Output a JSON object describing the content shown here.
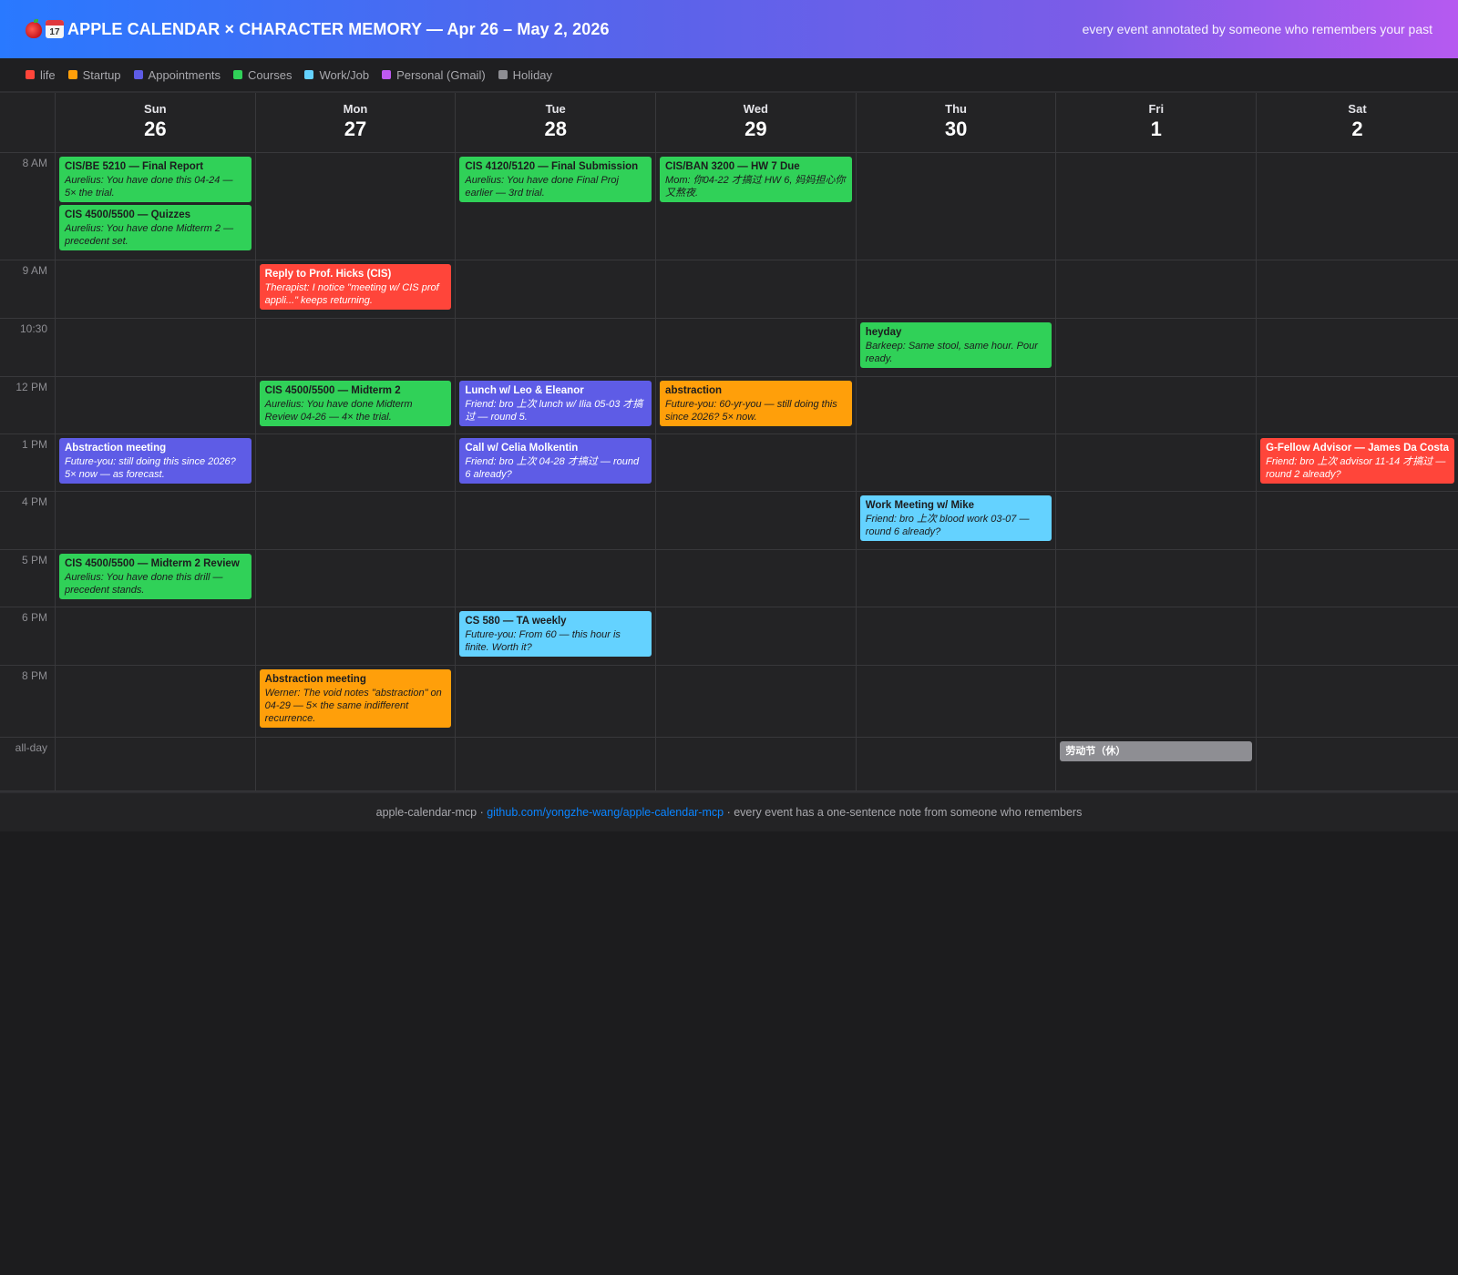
{
  "header": {
    "title": "APPLE CALENDAR × CHARACTER MEMORY — Apr 26 – May 2, 2026",
    "calendar_icon_day": "17",
    "subtitle": "every event annotated by someone who remembers your past"
  },
  "legend": [
    {
      "label": "life",
      "color": "#ff453a"
    },
    {
      "label": "Startup",
      "color": "#ff9f0a"
    },
    {
      "label": "Appointments",
      "color": "#5e5ce6"
    },
    {
      "label": "Courses",
      "color": "#30d158"
    },
    {
      "label": "Work/Job",
      "color": "#64d2ff"
    },
    {
      "label": "Personal (Gmail)",
      "color": "#bf5af2"
    },
    {
      "label": "Holiday",
      "color": "#8e8e93"
    }
  ],
  "days": [
    {
      "dow": "Sun",
      "num": "26"
    },
    {
      "dow": "Mon",
      "num": "27"
    },
    {
      "dow": "Tue",
      "num": "28"
    },
    {
      "dow": "Wed",
      "num": "29"
    },
    {
      "dow": "Thu",
      "num": "30"
    },
    {
      "dow": "Fri",
      "num": "1"
    },
    {
      "dow": "Sat",
      "num": "2"
    }
  ],
  "time_slots": [
    "8 AM",
    "9 AM",
    "10:30",
    "12 PM",
    "1 PM",
    "4 PM",
    "5 PM",
    "6 PM",
    "8 PM",
    "all-day"
  ],
  "events": {
    "e1": {
      "title": "CIS/BE 5210 — Final Report",
      "note": "Aurelius: You have done this 04-24 — 5× the trial."
    },
    "e2": {
      "title": "CIS 4500/5500 — Quizzes",
      "note": "Aurelius: You have done Midterm 2 — precedent set."
    },
    "e3": {
      "title": "CIS 4120/5120 — Final Submission",
      "note": "Aurelius: You have done Final Proj earlier — 3rd trial."
    },
    "e4": {
      "title": "CIS/BAN 3200 — HW 7 Due",
      "note": "Mom: 你04-22 才搞过 HW 6, 妈妈担心你又熬夜."
    },
    "e5": {
      "title": "Reply to Prof. Hicks (CIS)",
      "note": "Therapist: I notice \"meeting w/ CIS prof appli...\" keeps returning."
    },
    "e6": {
      "title": "heyday",
      "note": "Barkeep: Same stool, same hour. Pour ready."
    },
    "e7": {
      "title": "CIS 4500/5500 — Midterm 2",
      "note": "Aurelius: You have done Midterm Review 04-26 — 4× the trial."
    },
    "e8": {
      "title": "Lunch w/ Leo & Eleanor",
      "note": "Friend: bro 上次 lunch w/ Ilia 05-03 才搞过 — round 5."
    },
    "e9": {
      "title": "abstraction",
      "note": "Future-you: 60-yr-you — still doing this since 2026? 5× now."
    },
    "e10": {
      "title": "Abstraction meeting",
      "note": "Future-you: still doing this since 2026? 5× now — as forecast."
    },
    "e11": {
      "title": "Call w/ Celia Molkentin",
      "note": "Friend: bro 上次 04-28 才搞过 — round 6 already?"
    },
    "e12": {
      "title": "G-Fellow Advisor — James Da Costa",
      "note": "Friend: bro 上次 advisor 11-14 才搞过 — round 2 already?"
    },
    "e13": {
      "title": "Work Meeting w/ Mike",
      "note": "Friend: bro 上次 blood work 03-07 — round 6 already?"
    },
    "e14": {
      "title": "CIS 4500/5500 — Midterm 2 Review",
      "note": "Aurelius: You have done this drill — precedent stands."
    },
    "e15": {
      "title": "CS 580 — TA weekly",
      "note": "Future-you: From 60 — this hour is finite. Worth it?"
    },
    "e16": {
      "title": "Abstraction meeting",
      "note": "Werner: The void notes \"abstraction\" on 04-29 — 5× the same indifferent recurrence."
    },
    "e17": {
      "title": "劳动节（休）"
    }
  },
  "footer": {
    "prefix": "apple-calendar-mcp · ",
    "link": "github.com/yongzhe-wang/apple-calendar-mcp",
    "suffix": " · every event has a one-sentence note from someone who remembers"
  }
}
